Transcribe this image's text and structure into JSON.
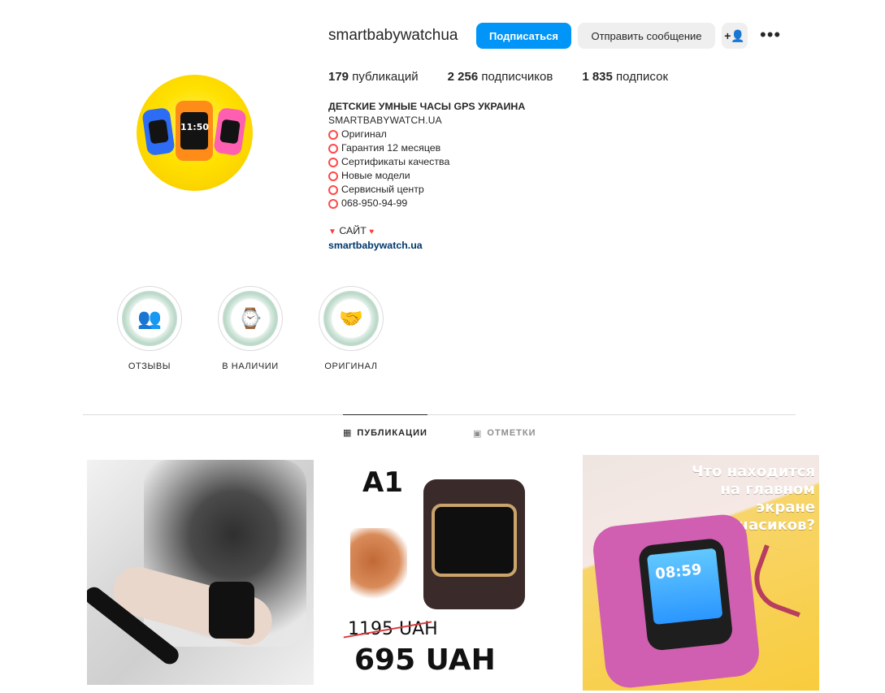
{
  "profile": {
    "username": "smartbabywatchua",
    "buttons": {
      "follow": "Подписаться",
      "message": "Отправить сообщение",
      "add": "+",
      "more": "•••"
    },
    "stats": [
      {
        "count": "179",
        "label": "публикаций"
      },
      {
        "count": "2 256",
        "label": "подписчиков"
      },
      {
        "count": "1 835",
        "label": "подписок"
      }
    ],
    "bio": {
      "title": "ДЕТСКИЕ УМНЫЕ ЧАСЫ GPS УКРАИНА",
      "subtitle": "SMARTBABYWATCH.UA",
      "lines": [
        "Оригинал",
        "Гарантия 12 месяцев",
        "Сертификаты качества",
        "Новые модели",
        "Сервисный центр",
        "068-950-94-99"
      ],
      "site_label": "САЙТ",
      "link": "smartbabywatch.ua"
    },
    "avatar": {
      "watch_time": "11:50"
    }
  },
  "highlights": [
    {
      "label": "ОТЗЫВЫ",
      "icon": "people-icon"
    },
    {
      "label": "В НАЛИЧИИ",
      "icon": "watch-icon"
    },
    {
      "label": "ОРИГИНАЛ",
      "icon": "handshake-icon"
    }
  ],
  "tabs": {
    "publications": "ПУБЛИКАЦИИ",
    "tagged": "ОТМЕТКИ"
  },
  "posts": {
    "p2": {
      "model": "A1",
      "old_price": "1195 UAH",
      "new_price": "695 UAH"
    },
    "p3": {
      "caption": "Что находится на главном экране часиков?",
      "time": "08:59"
    }
  },
  "colors": {
    "accent": "#0095f6",
    "link": "#00376b",
    "bio_icon": "#ff4848"
  }
}
